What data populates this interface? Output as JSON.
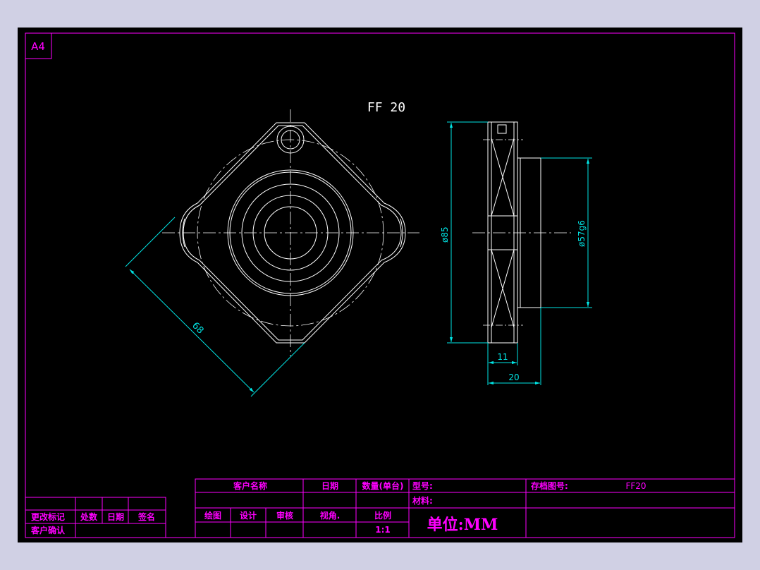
{
  "sheet": {
    "size_label": "A4",
    "part_title": "FF 20"
  },
  "dimensions": {
    "diagonal": "68",
    "outer_diameter": "ø85",
    "pilot_diameter": "ø57g6",
    "flange_thickness": "11",
    "overall_length": "20"
  },
  "title_block": {
    "customer_name_label": "客户名称",
    "date_label": "日期",
    "quantity_label": "数量(单台)",
    "model_label": "型号:",
    "archive_no_label": "存档图号:",
    "archive_no_value": "FF20",
    "material_label": "材料:",
    "drawn_label": "绘图",
    "design_label": "设计",
    "review_label": "审核",
    "view_angle_label": "视角.",
    "scale_label": "比例",
    "scale_value": "1:1",
    "unit_label": "单位:MM"
  },
  "revision_block": {
    "change_mark_label": "更改标记",
    "location_label": "处数",
    "date_label": "日期",
    "signature_label": "签名",
    "customer_confirm_label": "客户确认"
  },
  "colors": {
    "background": "#000000",
    "frame": "#ff00ff",
    "geometry": "#ffffff",
    "dimension": "#00e5e5",
    "title_text": "#ff00ff",
    "outer_bg": "#d0d0e4"
  }
}
